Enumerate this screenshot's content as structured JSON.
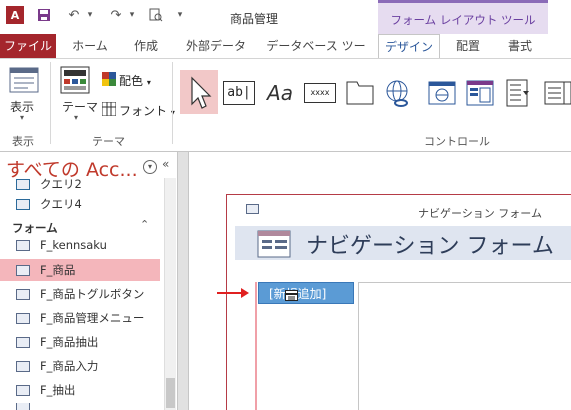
{
  "app": {
    "title": "商品管理",
    "contextual_label": "フォーム レイアウト ツール"
  },
  "ribbon_tabs": [
    {
      "label": "ファイル"
    },
    {
      "label": "ホーム"
    },
    {
      "label": "作成"
    },
    {
      "label": "外部データ"
    },
    {
      "label": "データベース ツール"
    },
    {
      "label": "デザイン"
    },
    {
      "label": "配置"
    },
    {
      "label": "書式"
    }
  ],
  "ribbon": {
    "view_label": "表示",
    "view_group": "表示",
    "theme_label": "テーマ",
    "color_label": "配色",
    "font_label": "フォント",
    "theme_group": "テーマ",
    "controls_group": "コントロール",
    "textbox_glyph": "ab|",
    "label_glyph": "Aa",
    "button_glyph": "xxxx"
  },
  "nav_pane": {
    "header": "すべての Acc...",
    "items": [
      {
        "label": "クエリ2",
        "kind": "query"
      },
      {
        "label": "クエリ4",
        "kind": "query"
      }
    ],
    "forms_group": "フォーム",
    "forms": [
      {
        "label": "F_kennsaku"
      },
      {
        "label": "F_商品"
      },
      {
        "label": "F_商品トグルボタン"
      },
      {
        "label": "F_商品管理メニュー"
      },
      {
        "label": "F_商品抽出"
      },
      {
        "label": "F_商品入力"
      },
      {
        "label": "F_抽出"
      }
    ]
  },
  "form": {
    "window_title": "ナビゲーション フォーム",
    "header": "ナビゲーション フォーム",
    "new_tab": "[新規追加]"
  },
  "colors": {
    "file_tab": "#a4262c",
    "accent_red": "#c0392b",
    "selected_nav": "#f4b6bb",
    "nav_button": "#5b9bd5"
  }
}
